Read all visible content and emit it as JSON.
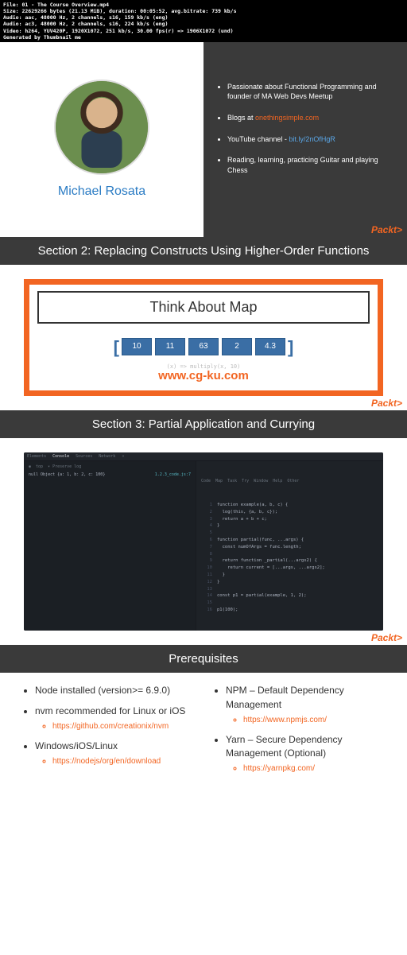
{
  "fileinfo": "File: 01 - The Course Overview.mp4\nSize: 22629266 bytes (21.13 MiB), duration: 00:05:52, avg.bitrate: 739 kb/s\nAudio: aac, 48000 Hz, 2 channels, s16, 159 kb/s (eng)\nAudio: ac3, 48000 Hz, 2 channels, s16, 224 kb/s (eng)\nVideo: h264, YUV420P, 1920X1072, 251 kb/s, 30.00 fps(r) => 1906X1072 (und)\nGenerated by Thumbnail me",
  "author": {
    "name": "Michael Rosata",
    "bullets": [
      {
        "text": "Passionate about Functional Programming and founder of MA Web Devs Meetup",
        "link": ""
      },
      {
        "prefix": "Blogs at ",
        "link": "onethingsimple.com"
      },
      {
        "prefix": "YouTube channel - ",
        "link2": "bit.ly/2nOfHgR"
      },
      {
        "text": "Reading, learning, practicing Guitar and playing Chess"
      }
    ]
  },
  "section2": {
    "header": "Section 2: Replacing Constructs Using Higher-Order Functions",
    "title": "Think About Map",
    "cells": [
      "10",
      "11",
      "63",
      "2",
      "4.3"
    ],
    "code": "(x) => multiply(x, 10)",
    "watermark": "www.cg-ku.com"
  },
  "section3": {
    "header": "Section 3: Partial Application and Currying",
    "tabs_left": [
      "Elements",
      "Console",
      "Sources",
      "Network"
    ],
    "preserve": "Preserve log",
    "console_line": "null  Object {a: 1, b: 2, c: 100}",
    "console_link": "1.2.3_code.js:7",
    "tabs_right": "Code  Map  Task  Try  Window  Help  Other",
    "code_lines": [
      "function example(a, b, c) {",
      "  log(this, {a, b, c});",
      "  return a + b + c;",
      "}",
      "",
      "function partial(func, ...args) {",
      "  const numOfArgs = func.length;",
      "",
      "  return function _partial(...args2) {",
      "    return current = [...args, ...args2];",
      "  }",
      "}",
      "",
      "const p1 = partial(example, 1, 2);",
      "",
      "p1(100);"
    ]
  },
  "prereq": {
    "header": "Prerequisites",
    "left": [
      {
        "text": "Node installed (version>= 6.9.0)"
      },
      {
        "text": "nvm recommended for Linux or iOS",
        "sub": "https://github.com/creationix/nvm"
      },
      {
        "text": "Windows/iOS/Linux",
        "sub": "https://nodejs/org/en/download"
      }
    ],
    "right": [
      {
        "text": "NPM – Default Dependency Management",
        "sub": "https://www.npmjs.com/"
      },
      {
        "text": "Yarn – Secure Dependency Management (Optional)",
        "sub": "https://yarnpkg.com/"
      }
    ]
  },
  "packt": "Packt>"
}
